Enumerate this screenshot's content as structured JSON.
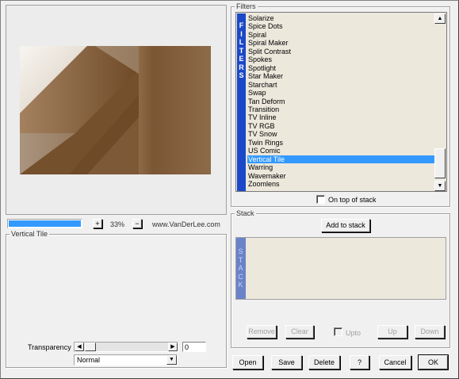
{
  "filters": {
    "group_label": "Filters",
    "strip_letters": [
      "F",
      "I",
      "L",
      "T",
      "E",
      "R",
      "S"
    ],
    "items": [
      "Solarize",
      "Spice Dots",
      "Spiral",
      "Spiral Maker",
      "Split Contrast",
      "Spokes",
      "Spotlight",
      "Star Maker",
      "Starchart",
      "Swap",
      "Tan Deform",
      "Transition",
      "TV Inline",
      "TV RGB",
      "TV Snow",
      "Twin Rings",
      "US Comic",
      "Vertical Tile",
      "Warring",
      "Wavemaker",
      "Zoomlens"
    ],
    "selected": "Vertical Tile",
    "on_top_label": "On top of stack",
    "on_top_checked": false
  },
  "preview": {
    "progress_fraction": 1.0,
    "zoom_in_label": "+",
    "zoom_value": "33%",
    "zoom_out_label": "−",
    "website": "www.VanDerLee.com"
  },
  "settings": {
    "group_label": "Vertical Tile",
    "transparency_label": "Transparency",
    "transparency_value": "0",
    "blend_mode": "Normal"
  },
  "stack": {
    "group_label": "Stack",
    "add_label": "Add to stack",
    "strip_letters": [
      "S",
      "T",
      "A",
      "C",
      "K"
    ],
    "remove_label": "Remove",
    "clear_label": "Clear",
    "upto_label": "Upto",
    "up_label": "Up",
    "down_label": "Down"
  },
  "footer": {
    "open_label": "Open",
    "save_label": "Save",
    "delete_label": "Delete",
    "help_label": "?",
    "cancel_label": "Cancel",
    "ok_label": "OK"
  },
  "colors": {
    "strip": "#1a48c8",
    "selection": "#3399ff",
    "progress": "#3399ff"
  }
}
